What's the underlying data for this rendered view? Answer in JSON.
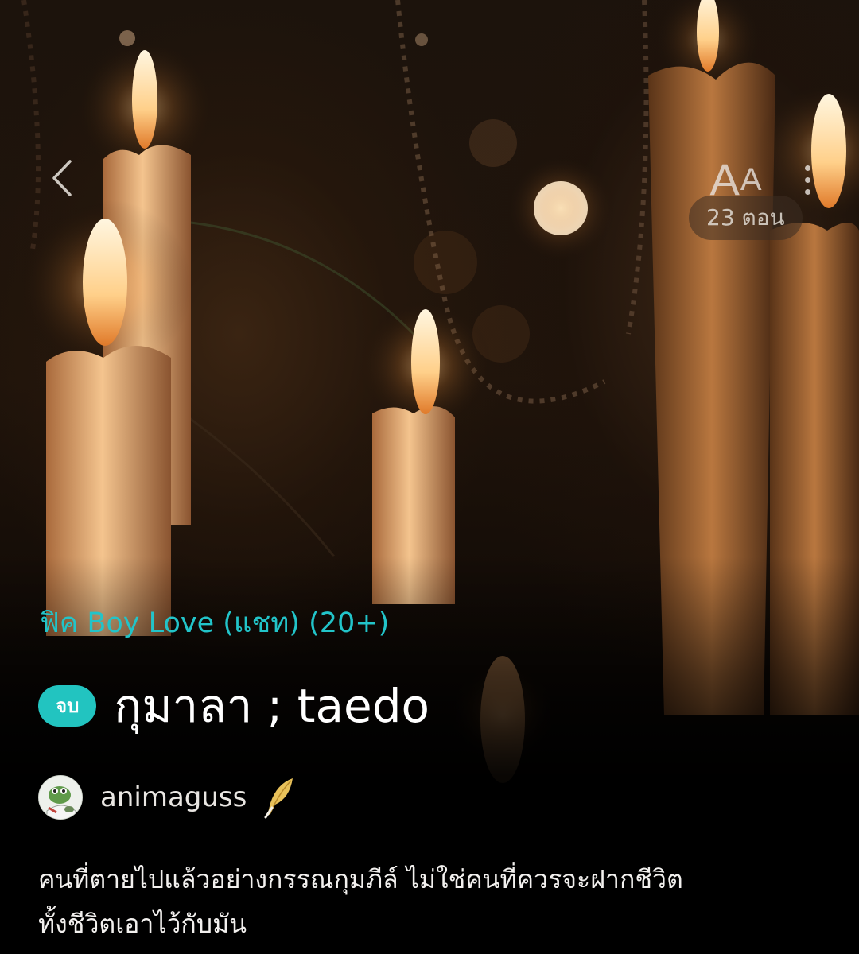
{
  "header": {
    "font_button": {
      "big": "A",
      "small": "A"
    },
    "episodes_label": "23 ตอน"
  },
  "novel": {
    "category": "ฟิค Boy Love (แชท) (20+)",
    "status_badge": "จบ",
    "title": "กุมาลา ; taedo",
    "author": "animaguss",
    "synopsis_lines": [
      "คนที่ตายไปแล้วอย่างกรรณกุมภีล์ ไม่ใช่คนที่ควรจะฝากชีวิต",
      "ทั้งชีวิตเอาไว้กับมัน"
    ]
  },
  "colors": {
    "accent": "#22c4c9",
    "badge_bg": "#22c4c0"
  },
  "icons": {
    "back": "chevron-left-icon",
    "more": "more-vertical-icon",
    "author_badge": "feather-quill-icon"
  }
}
